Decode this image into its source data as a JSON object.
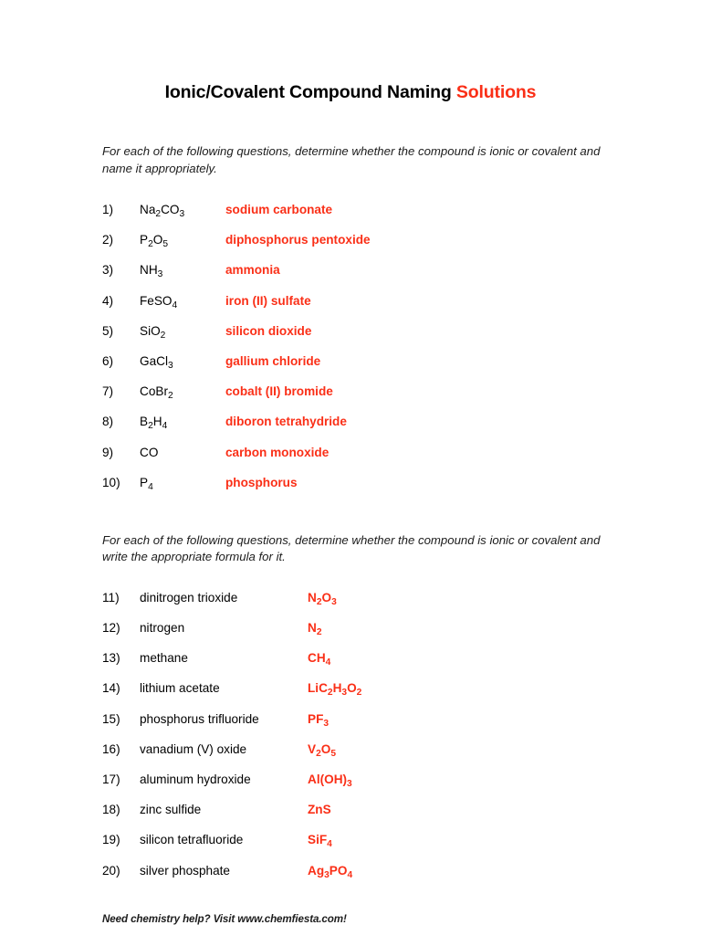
{
  "document": {
    "title_main": "Ionic/Covalent Compound Naming ",
    "title_accent": "Solutions",
    "accent_color": "#fa2f17",
    "text_color": "#000000"
  },
  "section_1": {
    "intro": "For each of the following questions, determine whether the compound is ionic or covalent and name it appropriately.",
    "items": [
      {
        "number": "1)",
        "formula_html": "Na<sub>2</sub>CO<sub>3</sub>",
        "formula_text": "Na2CO3",
        "answer": "sodium carbonate"
      },
      {
        "number": "2)",
        "formula_html": "P<sub>2</sub>O<sub>5</sub>",
        "formula_text": "P2O5",
        "answer": "diphosphorus pentoxide"
      },
      {
        "number": "3)",
        "formula_html": "NH<sub>3</sub>",
        "formula_text": "NH3",
        "answer": "ammonia"
      },
      {
        "number": "4)",
        "formula_html": "FeSO<sub>4</sub>",
        "formula_text": "FeSO4",
        "answer": "iron (II) sulfate"
      },
      {
        "number": "5)",
        "formula_html": "SiO<sub>2</sub>",
        "formula_text": "SiO2",
        "answer": "silicon dioxide"
      },
      {
        "number": "6)",
        "formula_html": "GaCl<sub>3</sub>",
        "formula_text": "GaCl3",
        "answer": "gallium chloride"
      },
      {
        "number": "7)",
        "formula_html": "CoBr<sub>2</sub>",
        "formula_text": "CoBr2",
        "answer": "cobalt (II) bromide"
      },
      {
        "number": "8)",
        "formula_html": "B<sub>2</sub>H<sub>4</sub>",
        "formula_text": "B2H4",
        "answer": "diboron tetrahydride"
      },
      {
        "number": "9)",
        "formula_html": "CO",
        "formula_text": "CO",
        "answer": "carbon monoxide"
      },
      {
        "number": "10)",
        "formula_html": "P<sub>4</sub>",
        "formula_text": "P4",
        "answer": "phosphorus"
      }
    ]
  },
  "section_2": {
    "intro": "For each of the following questions, determine whether the compound is ionic or covalent and write the appropriate formula for it.",
    "items": [
      {
        "number": "11)",
        "name": "dinitrogen trioxide",
        "formula_html": "N<sub>2</sub>O<sub>3</sub>",
        "formula_text": "N2O3"
      },
      {
        "number": "12)",
        "name": "nitrogen",
        "formula_html": "N<sub>2</sub>",
        "formula_text": "N2"
      },
      {
        "number": "13)",
        "name": "methane",
        "formula_html": "CH<sub>4</sub>",
        "formula_text": "CH4"
      },
      {
        "number": "14)",
        "name": "lithium acetate",
        "formula_html": "LiC<sub>2</sub>H<sub>3</sub>O<sub>2</sub>",
        "formula_text": "LiC2H3O2"
      },
      {
        "number": "15)",
        "name": "phosphorus trifluoride",
        "formula_html": "PF<sub>3</sub>",
        "formula_text": "PF3"
      },
      {
        "number": "16)",
        "name": "vanadium (V) oxide",
        "formula_html": "V<sub>2</sub>O<sub>5</sub>",
        "formula_text": "V2O5"
      },
      {
        "number": "17)",
        "name": "aluminum hydroxide",
        "formula_html": "Al(OH)<sub>3</sub>",
        "formula_text": "Al(OH)3"
      },
      {
        "number": "18)",
        "name": "zinc sulfide",
        "formula_html": "ZnS",
        "formula_text": "ZnS"
      },
      {
        "number": "19)",
        "name": "silicon tetrafluoride",
        "formula_html": "SiF<sub>4</sub>",
        "formula_text": "SiF4"
      },
      {
        "number": "20)",
        "name": "silver phosphate",
        "formula_html": "Ag<sub>3</sub>PO<sub>4</sub>",
        "formula_text": "Ag3PO4"
      }
    ]
  },
  "footer": {
    "text": "Need chemistry help?  Visit www.chemfiesta.com!"
  }
}
